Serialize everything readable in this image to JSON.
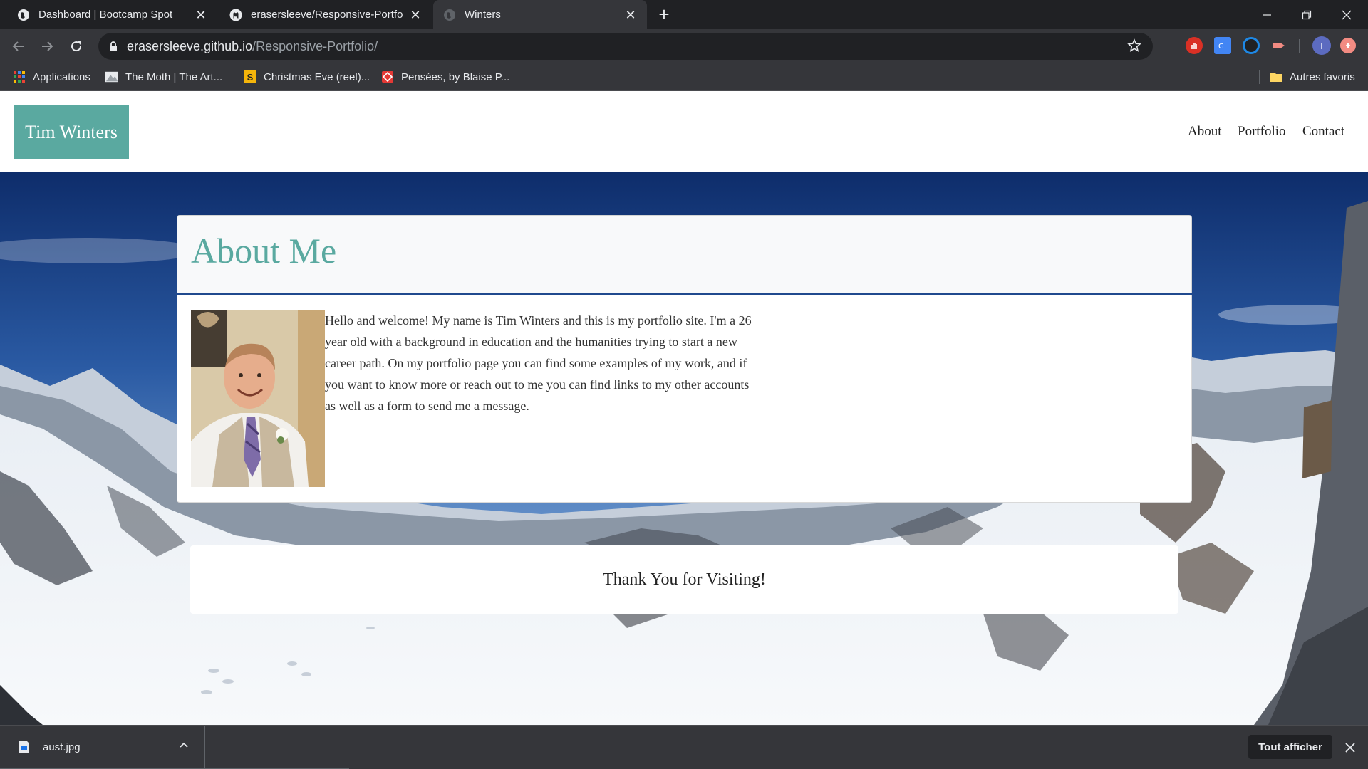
{
  "browser": {
    "tabs": [
      {
        "title": "Dashboard | Bootcamp Spot",
        "favicon": "globe-icon",
        "active": false
      },
      {
        "title": "erasersleeve/Responsive-Portfolio",
        "favicon": "github-icon",
        "active": false
      },
      {
        "title": "Winters",
        "favicon": "globe-icon",
        "active": true
      }
    ],
    "url_host": "erasersleeve.github.io",
    "url_path": "/Responsive-Portfolio/",
    "profile_initial": "T",
    "bookmarks": [
      {
        "label": "Applications",
        "icon": "apps-grid-icon"
      },
      {
        "label": "The Moth | The Art...",
        "icon": "moth-icon"
      },
      {
        "label": "Christmas Eve (reel)...",
        "icon": "s-letter-icon"
      },
      {
        "label": "Pensées, by Blaise P...",
        "icon": "red-diamond-icon"
      }
    ],
    "other_bookmarks": "Autres favoris"
  },
  "site": {
    "brand": "Tim Winters",
    "nav": [
      "About",
      "Portfolio",
      "Contact"
    ],
    "about_title": "About Me",
    "about_text": "Hello and welcome! My name is Tim Winters and this is my portfolio site. I'm a 26 year old with a background in education and the humanities trying to start a new career path. On my portfolio page you can find some examples of my work, and if you want to know more or reach out to me you can find links to my other accounts as well as a form to send me a message.",
    "footer": "Thank You for Visiting!",
    "accent_color": "#5aa9a0"
  },
  "downloads": {
    "file": "aust.jpg",
    "show_all": "Tout afficher"
  }
}
